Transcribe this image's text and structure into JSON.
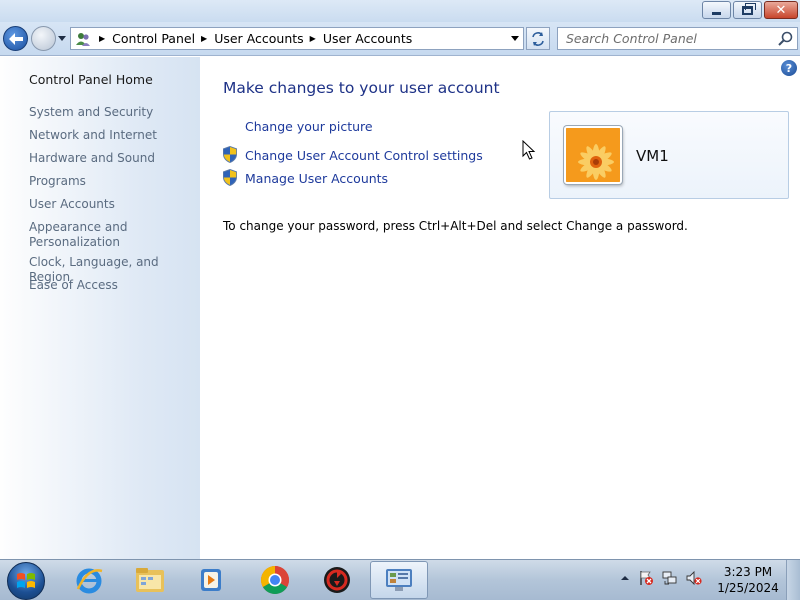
{
  "window": {
    "minimize_icon": "minimize-icon",
    "maximize_icon": "restore-icon",
    "close_icon": "close-icon"
  },
  "navbar": {
    "breadcrumbs": [
      "Control Panel",
      "User Accounts",
      "User Accounts"
    ],
    "search_placeholder": "Search Control Panel"
  },
  "left_pane": {
    "home": "Control Panel Home",
    "links": [
      "System and Security",
      "Network and Internet",
      "Hardware and Sound",
      "Programs",
      "User Accounts",
      "Appearance and Personalization",
      "Clock, Language, and Region",
      "Ease of Access"
    ]
  },
  "main": {
    "heading": "Make changes to your user account",
    "tasks": [
      {
        "label": "Change your picture",
        "icon": null
      },
      {
        "label": "Change User Account Control settings",
        "icon": "uac-shield-icon"
      },
      {
        "label": "Manage User Accounts",
        "icon": "uac-shield-icon"
      }
    ],
    "password_note": "To change your password, press Ctrl+Alt+Del and select Change a password.",
    "user": {
      "name": "VM1",
      "picture_icon": "orange-flower-picture"
    }
  },
  "taskbar": {
    "apps": [
      "internet-explorer-icon",
      "windows-explorer-icon",
      "media-player-icon",
      "chrome-icon",
      "recovery-app-icon",
      "control-panel-icon"
    ],
    "clock_time": "3:23 PM",
    "clock_date": "1/25/2024"
  },
  "colors": {
    "link": "#1e3a9c",
    "heading": "#1e3287",
    "left_pane_link": "#5a6b80"
  }
}
